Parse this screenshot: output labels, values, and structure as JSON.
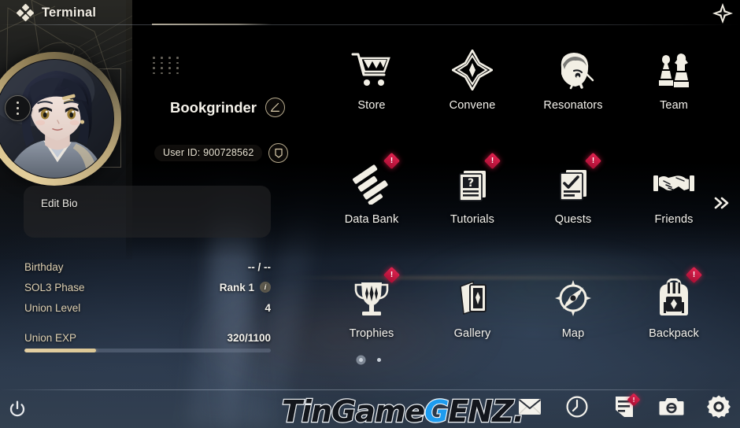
{
  "window": {
    "title": "Terminal",
    "title_icon": "four-diamond-icon",
    "close_icon": "close-star-icon"
  },
  "profile": {
    "avatar_menu_icon": "three-dot-vertical-icon",
    "player_name": "Bookgrinder",
    "edit_name_icon": "pencil-edit-icon",
    "user_id_label": "User ID: 900728562",
    "copy_icon": "copy-icon",
    "bio_label": "Edit Bio",
    "stats": [
      {
        "label": "Birthday",
        "value": "-- / --",
        "info": false
      },
      {
        "label": "SOL3 Phase",
        "value": "Rank 1",
        "info": true
      },
      {
        "label": "Union Level",
        "value": "4",
        "info": false
      }
    ],
    "exp": {
      "label": "Union EXP",
      "value": "320/1100",
      "current": 320,
      "max": 1100,
      "percent": 29
    }
  },
  "menu": {
    "items": [
      {
        "label": "Store",
        "icon": "shopping-cart-icon",
        "badge": null
      },
      {
        "label": "Convene",
        "icon": "compass-star-icon",
        "badge": null
      },
      {
        "label": "Resonators",
        "icon": "character-head-icon",
        "badge": null
      },
      {
        "label": "Team",
        "icon": "chess-pieces-icon",
        "badge": null
      },
      {
        "label": "Data Bank",
        "icon": "data-bank-icon",
        "badge": "!"
      },
      {
        "label": "Tutorials",
        "icon": "question-page-icon",
        "badge": "!"
      },
      {
        "label": "Quests",
        "icon": "checklist-page-icon",
        "badge": "!"
      },
      {
        "label": "Friends",
        "icon": "handshake-icon",
        "badge": null
      },
      {
        "label": "Trophies",
        "icon": "trophy-icon",
        "badge": "!"
      },
      {
        "label": "Gallery",
        "icon": "cards-icon",
        "badge": null
      },
      {
        "label": "Map",
        "icon": "compass-needle-icon",
        "badge": null
      },
      {
        "label": "Backpack",
        "icon": "backpack-icon",
        "badge": "!"
      }
    ],
    "next_page_icon": "double-chevron-right-icon",
    "pages": 2,
    "active_page": 1
  },
  "bottom_bar": {
    "power_icon": "power-icon",
    "tray": [
      {
        "icon": "mail-envelope-icon",
        "badge": null
      },
      {
        "icon": "clock-icon",
        "badge": null
      },
      {
        "icon": "notice-board-icon",
        "badge": "!"
      },
      {
        "icon": "camera-icon",
        "badge": null
      },
      {
        "icon": "gear-settings-icon",
        "badge": null
      }
    ]
  },
  "watermark": {
    "part1": "TinGame",
    "part2": "G",
    "part3": "ENZ."
  },
  "colors": {
    "accent_gold": "#e3cfa3",
    "badge_red": "#d81e48",
    "text_primary": "#f4f2ec",
    "text_label": "#ded0b2",
    "watermark_blue": "#1d9cf0"
  }
}
